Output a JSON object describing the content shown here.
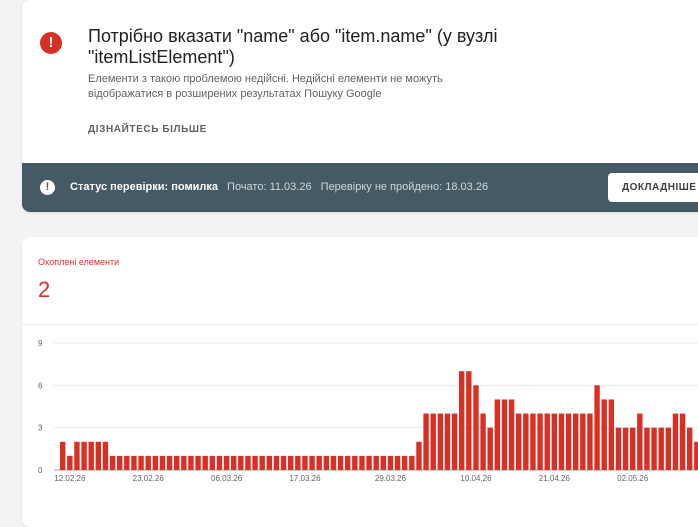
{
  "issue": {
    "title": "Потрібно вказати \"name\" або \"item.name\" (у вузлі \"itemListElement\")",
    "description": "Елементи з такою проблемою недійсні. Недійсні елементи не можуть відображатися в розширених результатах Пошуку Google",
    "learn_more": "ДІЗНАЙТЕСЬ БІЛЬШЕ",
    "icon": "error-icon",
    "color": "#d93025"
  },
  "status": {
    "label": "Статус перевірки: помилка",
    "started": "Почато: 11.03.26",
    "failed": "Перевірку не пройдено: 18.03.26",
    "details_button": "ДОКЛАДНІШЕ",
    "icon": "info-icon",
    "bar_color": "#455a64"
  },
  "chart_card": {
    "label": "Охоплені елементи",
    "value": "2"
  },
  "chart_data": {
    "type": "bar",
    "ylim": [
      0,
      9
    ],
    "yticks": [
      0,
      3,
      6,
      9
    ],
    "grid": true,
    "bar_color": "#d93025",
    "x_tick_labels": [
      "12.02.26",
      "23.02.26",
      "06.03.26",
      "17.03.26",
      "29.03.26",
      "10.04.26",
      "21.04.26",
      "02.05.26"
    ],
    "x_tick_indices": [
      1,
      12,
      23,
      34,
      46,
      58,
      69,
      80
    ],
    "values": [
      2,
      1,
      2,
      2,
      2,
      2,
      2,
      1,
      1,
      1,
      1,
      1,
      1,
      1,
      1,
      1,
      1,
      1,
      1,
      1,
      1,
      1,
      1,
      1,
      1,
      1,
      1,
      1,
      1,
      1,
      1,
      1,
      1,
      1,
      1,
      1,
      1,
      1,
      1,
      1,
      1,
      1,
      1,
      1,
      1,
      1,
      1,
      1,
      1,
      1,
      2,
      4,
      4,
      4,
      4,
      4,
      7,
      7,
      6,
      4,
      3,
      5,
      5,
      5,
      4,
      4,
      4,
      4,
      4,
      4,
      4,
      4,
      4,
      4,
      4,
      6,
      5,
      5,
      3,
      3,
      3,
      4,
      3,
      3,
      3,
      3,
      4,
      4,
      3,
      2
    ]
  }
}
